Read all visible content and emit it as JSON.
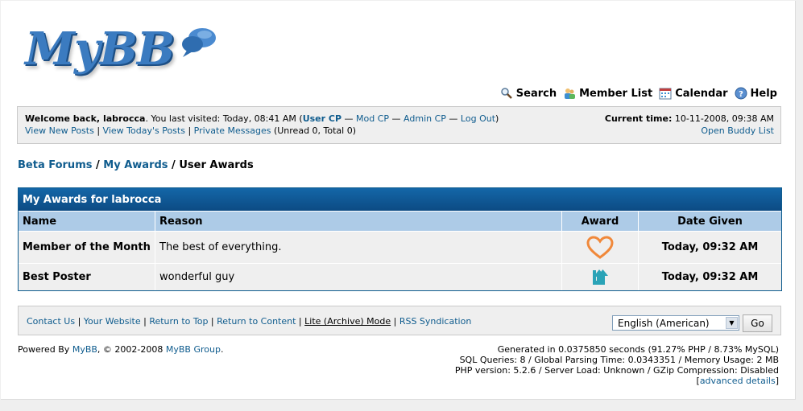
{
  "logo": {
    "text": "MyBB"
  },
  "top_menu": [
    {
      "label": "Search",
      "icon": "search-icon"
    },
    {
      "label": "Member List",
      "icon": "member-list-icon"
    },
    {
      "label": "Calendar",
      "icon": "calendar-icon"
    },
    {
      "label": "Help",
      "icon": "help-icon"
    }
  ],
  "welcome": {
    "greeting": "Welcome back, labrocca",
    "last_visited": ". You last visited: Today, 08:41 AM (",
    "user_cp": "User CP",
    "dash": " — ",
    "mod_cp": "Mod CP",
    "admin_cp": "Admin CP",
    "log_out": "Log Out",
    "close_paren": ")",
    "view_new_posts": "View New Posts",
    "pipe": " | ",
    "view_todays_posts": "View Today's Posts",
    "private_messages": "Private Messages",
    "pm_counts": " (Unread 0, Total 0)",
    "current_time_label": "Current time:",
    "current_time_value": " 10-11-2008, 09:38 AM",
    "open_buddy_list": "Open Buddy List"
  },
  "breadcrumb": {
    "home": "Beta Forums",
    "sep": " / ",
    "section": "My Awards",
    "current": "User Awards"
  },
  "table": {
    "title": "My Awards for labrocca",
    "columns": [
      "Name",
      "Reason",
      "Award",
      "Date Given"
    ],
    "rows": [
      {
        "name": "Member of the Month",
        "reason": "The best of everything.",
        "award_icon": "heart-icon",
        "date": "Today, 09:32 AM"
      },
      {
        "name": "Best Poster",
        "reason": "wonderful guy",
        "award_icon": "arrow-up-icon",
        "date": "Today, 09:32 AM"
      }
    ]
  },
  "footer": {
    "links": [
      "Contact Us",
      "Your Website",
      "Return to Top",
      "Return to Content",
      "Lite (Archive) Mode",
      "RSS Syndication"
    ],
    "pipe": " | ",
    "language": "English (American)",
    "go": "Go"
  },
  "powered": {
    "prefix": "Powered By ",
    "mybb": "MyBB",
    "middle": ", © 2002-2008 ",
    "group": "MyBB Group",
    "suffix": "."
  },
  "stats": {
    "line1": "Generated in 0.0375850 seconds (91.27% PHP / 8.73% MySQL)",
    "line2": "SQL Queries: 8 / Global Parsing Time: 0.0343351 / Memory Usage: 2 MB",
    "line3": "PHP version: 5.2.6 / Server Load: Unknown / GZip Compression: Disabled",
    "advanced_open": "[",
    "advanced": "advanced details",
    "advanced_close": "]"
  },
  "colors": {
    "link": "#0f5c8e",
    "thead": "#0c4b83",
    "column_header": "#adcbe7",
    "panel_bg": "#efefef",
    "heart": "#f0883a",
    "arrow": "#2aa3b7"
  }
}
